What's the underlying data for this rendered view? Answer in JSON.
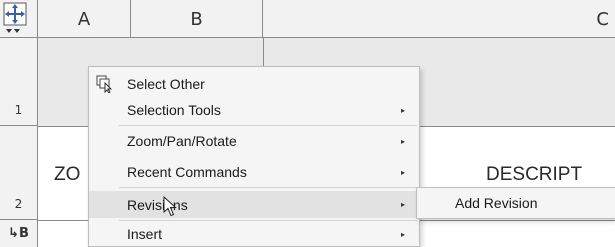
{
  "grid": {
    "columns": [
      {
        "id": "A",
        "label": "A"
      },
      {
        "id": "B",
        "label": "B"
      },
      {
        "id": "C",
        "label": "C"
      }
    ],
    "rows": [
      {
        "label": "1"
      },
      {
        "label": "2"
      },
      {
        "label": "↳B"
      }
    ],
    "cells": {
      "a2": "ZO",
      "c2": "DESCRIPT"
    }
  },
  "context_menu": {
    "items": [
      {
        "label": "Select Other",
        "icon": "select-other-icon",
        "submenu": false
      },
      {
        "label": "Selection Tools",
        "submenu": true
      },
      {
        "label": "Zoom/Pan/Rotate",
        "submenu": true
      },
      {
        "label": "Recent Commands",
        "submenu": true
      },
      {
        "label": "Revisions",
        "submenu": true,
        "highlighted": true
      },
      {
        "label": "Insert",
        "submenu": true
      }
    ]
  },
  "submenu": {
    "items": [
      {
        "label": "Add Revision"
      }
    ]
  },
  "colors": {
    "grid_line": "#8a8a8a",
    "header_bg": "#f2f2f2",
    "band_bg": "#e9e9e9",
    "menu_bg": "#f5f5f5",
    "menu_highlight": "#e2e2e2",
    "move_handle_blue": "#3b5ea8"
  },
  "icons": {
    "corner": "move-handle-icon",
    "pointer": "mouse-pointer-icon"
  }
}
